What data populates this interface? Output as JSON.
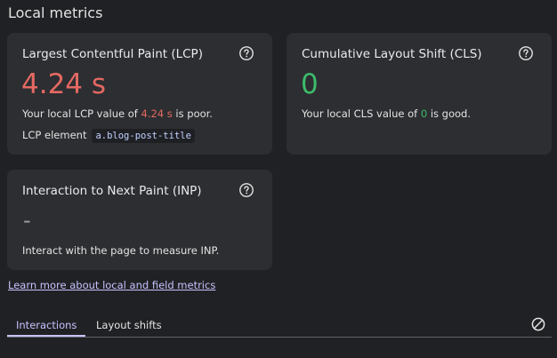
{
  "header": {
    "title": "Local metrics"
  },
  "lcp": {
    "title": "Largest Contentful Paint (LCP)",
    "value": "4.24 s",
    "desc_prefix": "Your local LCP value of ",
    "desc_value": "4.24 s",
    "desc_suffix": " is poor.",
    "element_label": "LCP element",
    "element_selector": "a.blog-post-title",
    "rating_color": "#e46962"
  },
  "cls": {
    "title": "Cumulative Layout Shift (CLS)",
    "value": "0",
    "desc_prefix": "Your local CLS value of ",
    "desc_value": "0",
    "desc_suffix": " is good.",
    "rating_color": "#3dbb6b"
  },
  "inp": {
    "title": "Interaction to Next Paint (INP)",
    "value": "-",
    "desc": "Interact with the page to measure INP."
  },
  "links": {
    "learn_more": "Learn more about local and field metrics"
  },
  "tabs": {
    "items": [
      {
        "label": "Interactions",
        "selected": true
      },
      {
        "label": "Layout shifts",
        "selected": false
      }
    ]
  },
  "icons": {
    "help": "help-circle-icon",
    "clear": "clear-block-icon"
  },
  "colors": {
    "accent": "#c6c3ff",
    "poor": "#e46962",
    "good": "#3dbb6b",
    "card_bg": "#2d2e31",
    "page_bg": "#202124"
  }
}
